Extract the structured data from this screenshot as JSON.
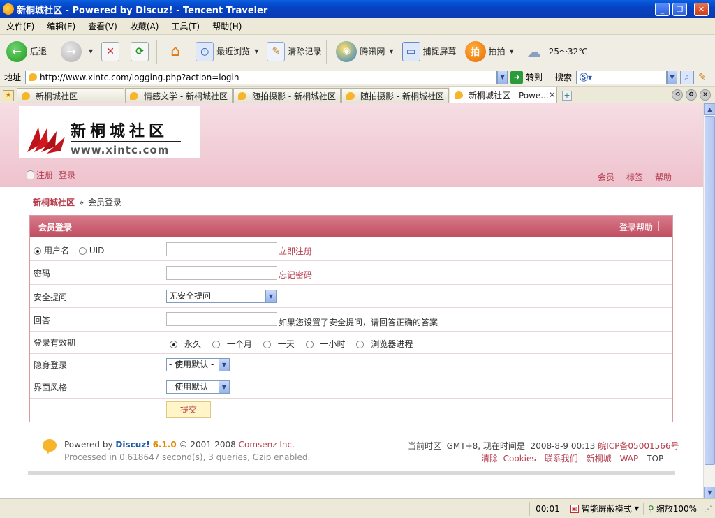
{
  "window": {
    "title": "新桐城社区 - Powered by Discuz! - Tencent Traveler"
  },
  "menu": [
    "文件(F)",
    "编辑(E)",
    "查看(V)",
    "收藏(A)",
    "工具(T)",
    "帮助(H)"
  ],
  "toolbar": {
    "back": "后退",
    "recent": "最近浏览",
    "clear": "清除记录",
    "tencent": "腾讯网",
    "capture": "捕捉屏幕",
    "paipai": "拍拍",
    "paipai_icon": "拍",
    "weather": "25～32℃"
  },
  "address": {
    "label": "地址",
    "url": "http://www.xintc.com/logging.php?action=login",
    "go": "转到",
    "search_label": "搜索"
  },
  "tabs": [
    {
      "label": "新桐城社区"
    },
    {
      "label": "情感文学 - 新桐城社区"
    },
    {
      "label": "随拍摄影 - 新桐城社区"
    },
    {
      "label": "随拍摄影 - 新桐城社区"
    },
    {
      "label": "新桐城社区 - Powe..."
    }
  ],
  "site": {
    "logo_cn": "新桐城社区",
    "logo_url": "www.xintc.com",
    "top_left": {
      "register": "注册",
      "login": "登录"
    },
    "top_right": [
      "会员",
      "标签",
      "帮助"
    ]
  },
  "breadcrumb": {
    "home": "新桐城社区",
    "sep": "»",
    "current": "会员登录"
  },
  "form": {
    "header": "会员登录",
    "help": "登录帮助",
    "username_label": "用户名",
    "uid_label": "UID",
    "register_link": "立即注册",
    "password_label": "密码",
    "forgot_link": "忘记密码",
    "question_label": "安全提问",
    "question_value": "无安全提问",
    "answer_label": "回答",
    "answer_hint": "如果您设置了安全提问，请回答正确的答案",
    "validity_label": "登录有效期",
    "validity_options": [
      "永久",
      "一个月",
      "一天",
      "一小时",
      "浏览器进程"
    ],
    "invisible_label": "隐身登录",
    "invisible_value": "- 使用默认 -",
    "style_label": "界面风格",
    "style_value": "- 使用默认 -",
    "submit": "提交"
  },
  "footer": {
    "powered_by": "Powered by",
    "discuz": "Discuz!",
    "version": "6.1.0",
    "copyright": "© 2001-2008",
    "comsenz": "Comsenz Inc.",
    "processed": "Processed in 0.618647 second(s), 3 queries, Gzip enabled.",
    "timezone": "当前时区  GMT+8, 现在时间是  2008-8-9 00:13",
    "icp": "皖ICP备05001566号",
    "links": [
      "清除  Cookies",
      "联系我们",
      "新桐城",
      "WAP",
      "TOP"
    ]
  },
  "status": {
    "time": "00:01",
    "block_mode": "智能屏蔽模式",
    "zoom": "缩放100%"
  },
  "colors": {
    "accent": "#B43D4E",
    "header_bar": "#C45A6B",
    "title_bar": "#0A47C8"
  }
}
